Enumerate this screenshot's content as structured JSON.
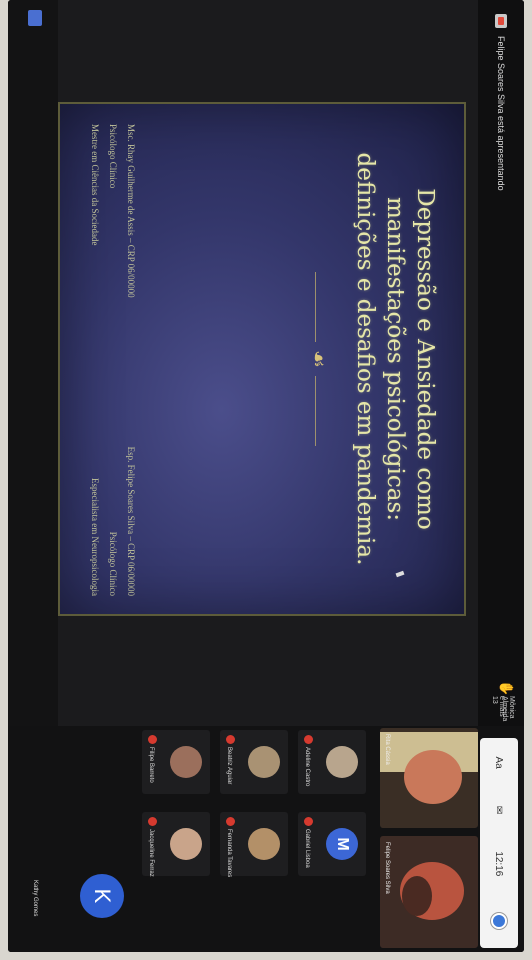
{
  "topbar": {
    "presenter_text": "Felipe Soares Silva está apresentando",
    "raised_name": "Mônica Almeida",
    "raised_sub": "e mais 13"
  },
  "tray": {
    "icons": [
      "Aa",
      "✉",
      "12:16"
    ]
  },
  "videos": [
    {
      "label": "Rita Cássia"
    },
    {
      "label": "Felipe Soares Silva"
    }
  ],
  "participants": [
    {
      "name": "Adeline Castro",
      "letter": ""
    },
    {
      "name": "Beatriz Aguiar",
      "letter": ""
    },
    {
      "name": "Filipe Barreto",
      "letter": ""
    },
    {
      "name": "Gabriel Lisboa",
      "letter": "M"
    },
    {
      "name": "Fernanda Tavares",
      "letter": ""
    },
    {
      "name": "Jacqueline Ferraz",
      "letter": ""
    }
  ],
  "big_avatar": {
    "letter": "K",
    "name": "Kathy Gomes"
  },
  "slide": {
    "title_lines": [
      "Depressão e Ansiedade como",
      "manifestações psicológicas:",
      "definições e desafios em pandemia."
    ],
    "ornament": "☙",
    "left_author": [
      "Msc. Rhay Guilherme de Assis – CRP 06/00000",
      "Psicólogo Clínico",
      "Mestre em Ciências da Sociedade"
    ],
    "right_author": [
      "Esp. Felipe Soares Silva – CRP 06/00000",
      "Psicólogo Clínico",
      "Especialista em Neuropsicologia"
    ]
  }
}
